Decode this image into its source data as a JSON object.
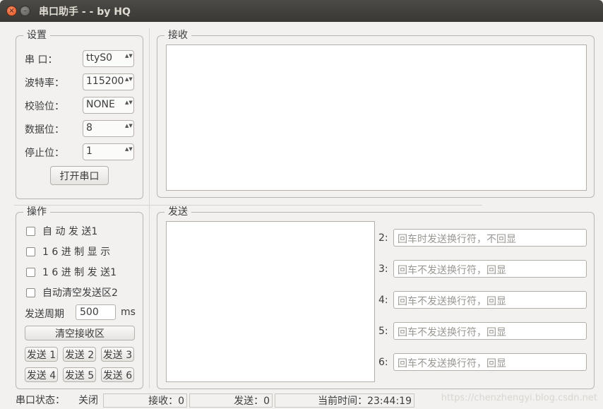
{
  "window": {
    "title": "串口助手 -  - by HQ",
    "close_glyph": "×",
    "minimize_glyph": "–"
  },
  "settings": {
    "group_title": "设置",
    "port_label": "串    口：",
    "port_value": "ttyS0",
    "baud_label": "波特率：",
    "baud_value": "115200",
    "parity_label": "校验位：",
    "parity_value": "NONE",
    "databits_label": "数据位：",
    "databits_value": "8",
    "stopbits_label": "停止位：",
    "stopbits_value": "1",
    "open_button": "打开串口",
    "spin_arrows": "▲▼"
  },
  "receive": {
    "group_title": "接收"
  },
  "operation": {
    "group_title": "操作",
    "auto_send": "自  动  发  送1",
    "hex_display": "1  6  进 制 显 示",
    "hex_send": "1  6  进 制 发 送1",
    "auto_clear": "自动清空发送区2",
    "period_label": "发送周期",
    "period_value": "500",
    "period_unit": "ms",
    "clear_button": "清空接收区",
    "send_buttons": [
      "发送 1",
      "发送 2",
      "发送 3",
      "发送 4",
      "发送 5",
      "发送 6"
    ]
  },
  "send": {
    "group_title": "发送",
    "rows": [
      {
        "label": "2:",
        "placeholder": "回车时发送换行符，不回显"
      },
      {
        "label": "3:",
        "placeholder": "回车不发送换行符，回显"
      },
      {
        "label": "4:",
        "placeholder": "回车不发送换行符，回显"
      },
      {
        "label": "5:",
        "placeholder": "回车不发送换行符，回显"
      },
      {
        "label": "6:",
        "placeholder": "回车不发送换行符，回显"
      }
    ]
  },
  "status": {
    "port_status_label": "串口状态：",
    "port_status_value": "关闭",
    "rx": "接收：0",
    "tx": "发送：0",
    "time": "当前时间：23:44:19"
  },
  "watermark": "https://chenzhengyi.blog.csdn.net"
}
